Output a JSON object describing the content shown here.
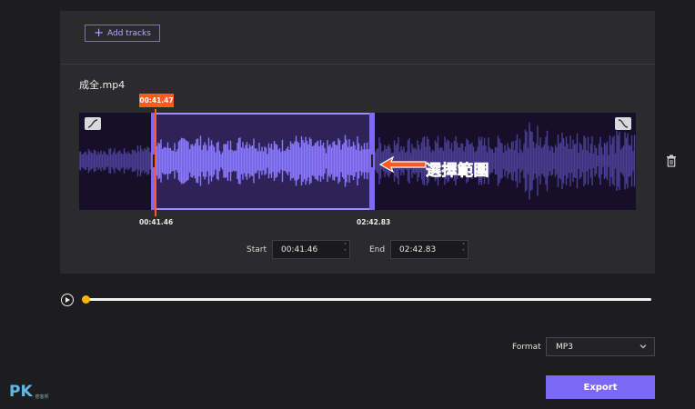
{
  "toolbar": {
    "add_tracks_label": "Add tracks"
  },
  "track": {
    "file_name": "成全.mp4",
    "playhead_time": "00:41.47",
    "selection_start_label": "00:41.46",
    "selection_end_label": "02:42.83",
    "annotation": "選擇範圍",
    "start_field_label": "Start",
    "start_value": "00:41.46",
    "end_field_label": "End",
    "end_value": "02:42.83"
  },
  "playback": {
    "progress": 0.0
  },
  "export": {
    "format_label": "Format",
    "format_value": "MP3",
    "export_label": "Export"
  },
  "watermark": {
    "logo": "PK",
    "sub": "痞客邦"
  },
  "colors": {
    "accent": "#7d68f5",
    "playhead": "#ff5a1f",
    "waveform": "#8f7bff",
    "progress_thumb": "#ffb400"
  },
  "icons": {
    "fade_in": "fade-in-curve-icon",
    "fade_out": "fade-out-curve-icon",
    "trash": "trash-icon",
    "play": "play-icon",
    "chevron": "chevron-down-icon"
  }
}
